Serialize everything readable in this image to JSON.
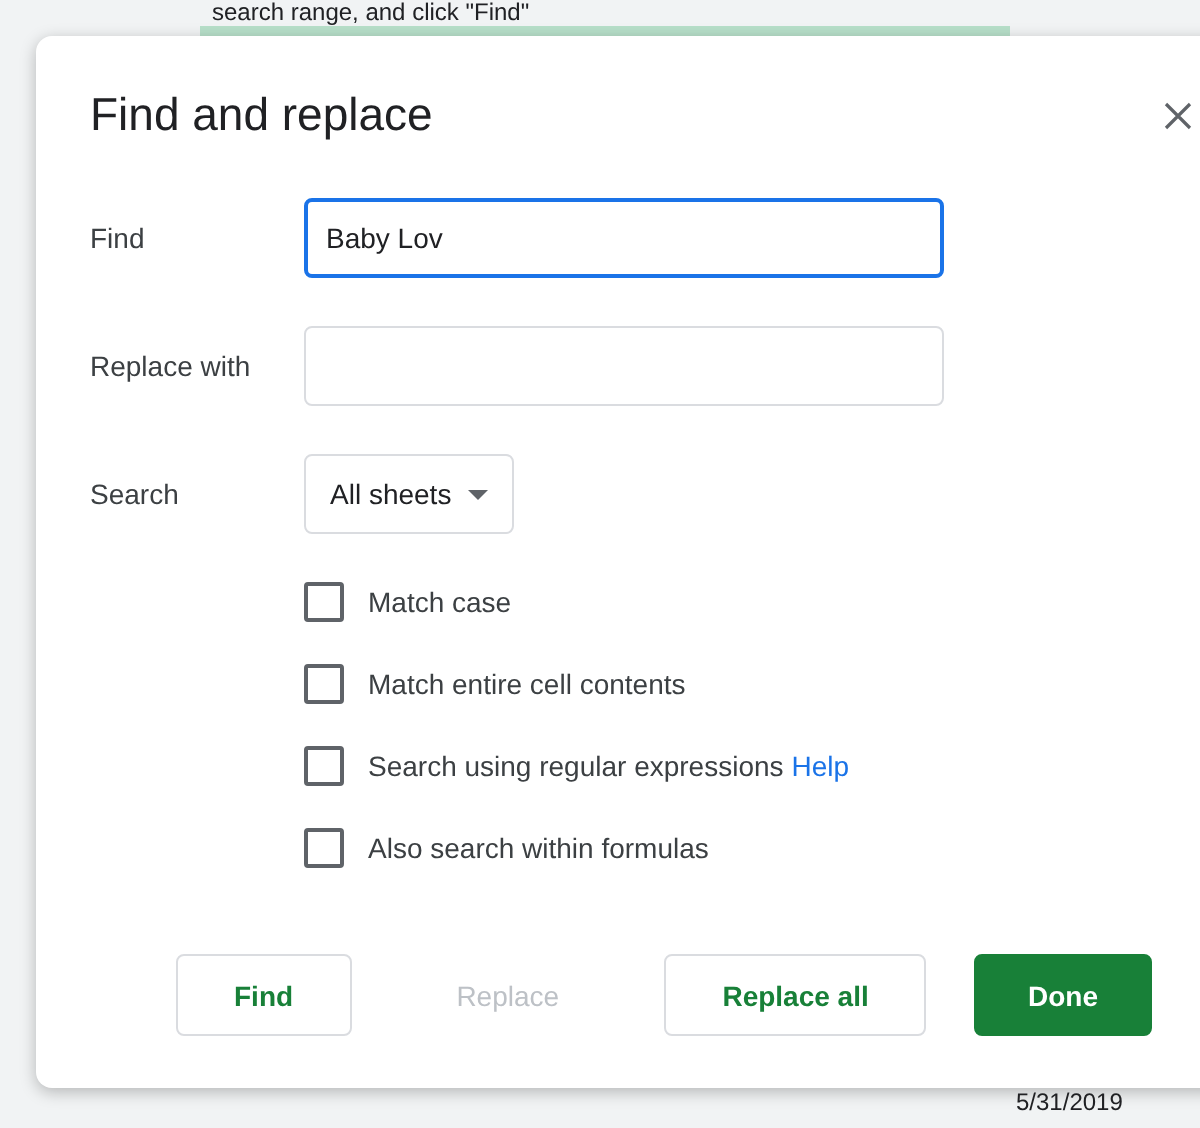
{
  "background": {
    "instruction": "search range, and click \"Find\"",
    "date": "5/31/2019"
  },
  "dialog": {
    "title": "Find and replace",
    "fields": [
      {
        "label": "Find",
        "kind": "text",
        "value": "Baby Lov",
        "focused": true
      },
      {
        "label": "Replace with",
        "kind": "text",
        "focused": false
      },
      {
        "label": "Search",
        "kind": "dropdown",
        "value": "All sheets",
        "focused": false
      }
    ],
    "options": [
      {
        "label": "Match case",
        "checked": false
      },
      {
        "label": "Match entire cell contents",
        "checked": false
      },
      {
        "label": "Search using regular expressions",
        "checked": false,
        "link": "Help"
      },
      {
        "label": "Also search within formulas",
        "checked": false
      }
    ],
    "buttons": [
      {
        "label": "Find",
        "kind": "secondary",
        "disabled": false
      },
      {
        "label": "Replace",
        "kind": "secondary",
        "disabled": true
      },
      {
        "label": "Replace all",
        "kind": "secondary",
        "disabled": false
      },
      {
        "label": "Done",
        "kind": "primary",
        "disabled": false
      }
    ]
  }
}
